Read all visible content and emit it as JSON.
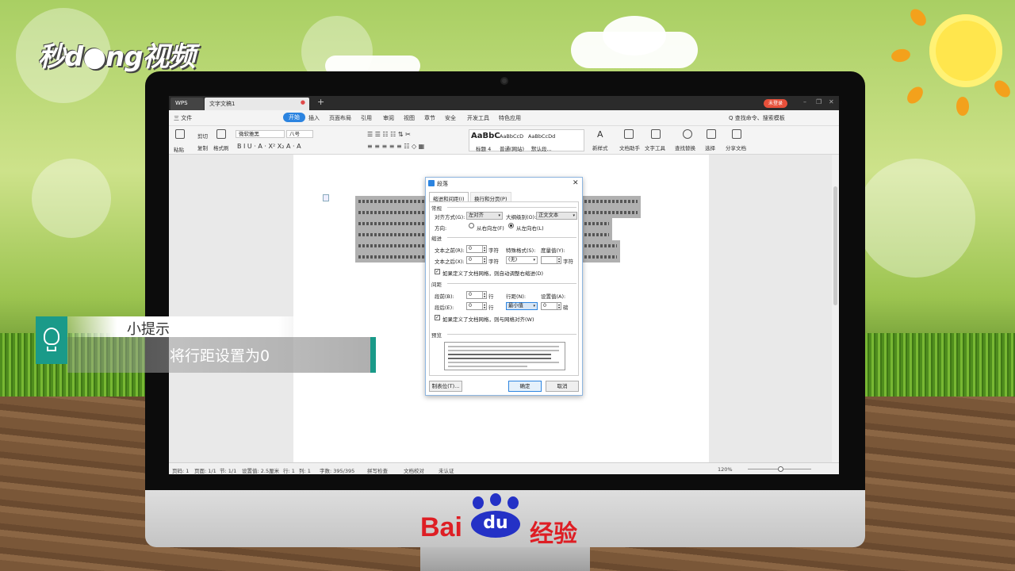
{
  "branding": {
    "top_logo": "秒d●ng视频",
    "bottom_logo_left": "Bai",
    "bottom_logo_paw": "du",
    "bottom_logo_right": "经验"
  },
  "titlebar": {
    "wps_tab": "WPS",
    "doc_tab": "文字文稿1",
    "login": "未登录"
  },
  "menu": {
    "file": "三 文件",
    "items": [
      "开始",
      "插入",
      "页面布局",
      "引用",
      "审阅",
      "视图",
      "章节",
      "安全",
      "开发工具",
      "特色应用"
    ],
    "search": "Q 查找命令、搜索模板"
  },
  "ribbon": {
    "paste": "粘贴",
    "cut": "剪切",
    "copy": "复制",
    "format_painter": "格式刷",
    "font_name": "微软雅黑",
    "font_size": "八号",
    "styles": [
      {
        "preview": "AaBbC",
        "label": "标题 4"
      },
      {
        "preview": "AaBbCcD",
        "label": "普通(网站)"
      },
      {
        "preview": "AaBbCcDd",
        "label": "默认段..."
      }
    ],
    "new_style": "新样式",
    "doc_helper": "文档助手",
    "text_tools": "文字工具",
    "find_replace": "查找替换",
    "select": "选择",
    "share": "分享文档"
  },
  "dialog": {
    "title": "段落",
    "tabs": [
      "缩进和间距(I)",
      "换行和分页(P)"
    ],
    "general": {
      "section": "常规",
      "align_label": "对齐方式(G):",
      "align_value": "左对齐",
      "outline_label": "大纲级别(O):",
      "outline_value": "正文文本",
      "direction_label": "方向:",
      "rtl": "从右向左(F)",
      "ltr": "从左向右(L)"
    },
    "indent": {
      "section": "缩进",
      "before_label": "文本之前(R):",
      "before_value": "0",
      "after_label": "文本之后(X):",
      "after_value": "0",
      "unit": "字符",
      "special_label": "特殊格式(S):",
      "special_value": "(无)",
      "measure_label": "度量值(Y):",
      "measure_value": "",
      "auto_adjust": "如果定义了文档网格，则自动调整右缩进(D)"
    },
    "spacing": {
      "section": "间距",
      "before_label": "段前(B):",
      "before_value": "0",
      "after_label": "段后(E):",
      "after_value": "0",
      "unit": "行",
      "line_label": "行距(N):",
      "line_value": "最小值",
      "set_label": "设置值(A):",
      "set_value": "0",
      "set_unit": "磅",
      "snap_grid": "如果定义了文档网格，则与网格对齐(W)"
    },
    "preview_label": "预览",
    "tabs_button": "制表位(T)...",
    "ok": "确定",
    "cancel": "取消"
  },
  "statusbar": {
    "page": "页码: 1",
    "pages": "页面: 1/1",
    "section": "节: 1/1",
    "position": "设置值: 2.5厘米",
    "row": "行: 1",
    "col": "列: 1",
    "words": "字数: 395/395",
    "spell": "拼写检查",
    "proof": "文档校对",
    "cert": "未认证",
    "zoom": "120%"
  },
  "tip": {
    "title": "小提示",
    "body": "将行距设置为0"
  },
  "colors": {
    "accent": "#2c84e0",
    "teal": "#1a9a89",
    "baidu_red": "#de1e24",
    "baidu_blue": "#2431c6"
  }
}
